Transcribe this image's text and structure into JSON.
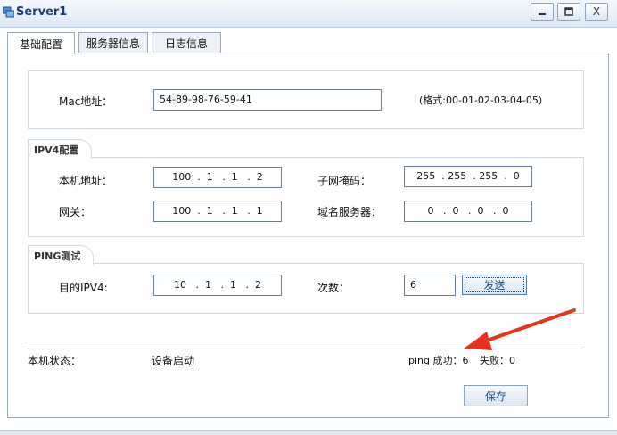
{
  "window": {
    "title": "Server1",
    "minimize_icon": "minimize-icon",
    "maximize_icon": "maximize-icon",
    "close_label": "X"
  },
  "tabs": [
    {
      "label": "基础配置",
      "active": true
    },
    {
      "label": "服务器信息",
      "active": false
    },
    {
      "label": "日志信息",
      "active": false
    }
  ],
  "mac": {
    "label": "Mac地址：",
    "value": "54-89-98-76-59-41",
    "hint": "(格式:00-01-02-03-04-05)"
  },
  "ipv4": {
    "group_title": "IPV4配置",
    "local_addr_label": "本机地址：",
    "local_addr_value": "100  .  1   .  1   .  2",
    "subnet_label": "子网掩码：",
    "subnet_value": "255  . 255  . 255  .  0",
    "gateway_label": "网关：",
    "gateway_value": "100  .  1   .  1   .  1",
    "dns_label": "域名服务器：",
    "dns_value": "0   .  0   .  0   .  0"
  },
  "ping": {
    "group_title": "PING测试",
    "target_label": "目的IPV4:",
    "target_value": "10   .  1   .  1   .  2",
    "count_label": "次数：",
    "count_value": "6",
    "send_label": "发送"
  },
  "status": {
    "label": "本机状态：",
    "value": "设备启动",
    "ping_text": "ping 成功：6",
    "fail_text": "失败：0"
  },
  "save_label": "保存",
  "colors": {
    "annotation_arrow": "#e8321e",
    "accent": "#1e4e8c"
  }
}
